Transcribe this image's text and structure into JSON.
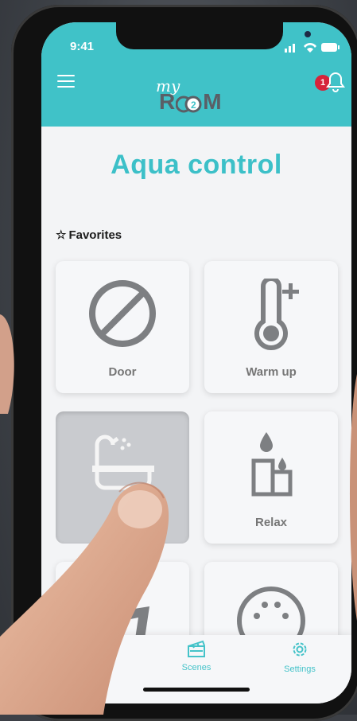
{
  "status_bar": {
    "time": "9:41"
  },
  "header": {
    "logo_top": "my",
    "logo_main": "R  M",
    "logo_inner": "2",
    "notification_count": "1"
  },
  "page": {
    "title": "Aqua control"
  },
  "favorites": {
    "star": "☆",
    "label": "Favorites",
    "tiles": [
      {
        "label": "Door",
        "icon": "no-entry-icon"
      },
      {
        "label": "Warm up",
        "icon": "thermometer-plus-icon"
      },
      {
        "label": "",
        "icon": "bathtub-shower-icon",
        "state": "pressed"
      },
      {
        "label": "Relax",
        "icon": "candle-drop-icon"
      },
      {
        "label": "",
        "icon": "music-icon"
      },
      {
        "label": "",
        "icon": "dial-palette-icon"
      }
    ]
  },
  "tabbar": {
    "items": [
      {
        "label": "Scenes",
        "icon": "clapperboard-icon"
      },
      {
        "label": "Settings",
        "icon": "gear-icon"
      }
    ]
  },
  "colors": {
    "accent": "#40c2c8",
    "badge": "#d6233a",
    "icon_gray": "#7d7f82"
  }
}
